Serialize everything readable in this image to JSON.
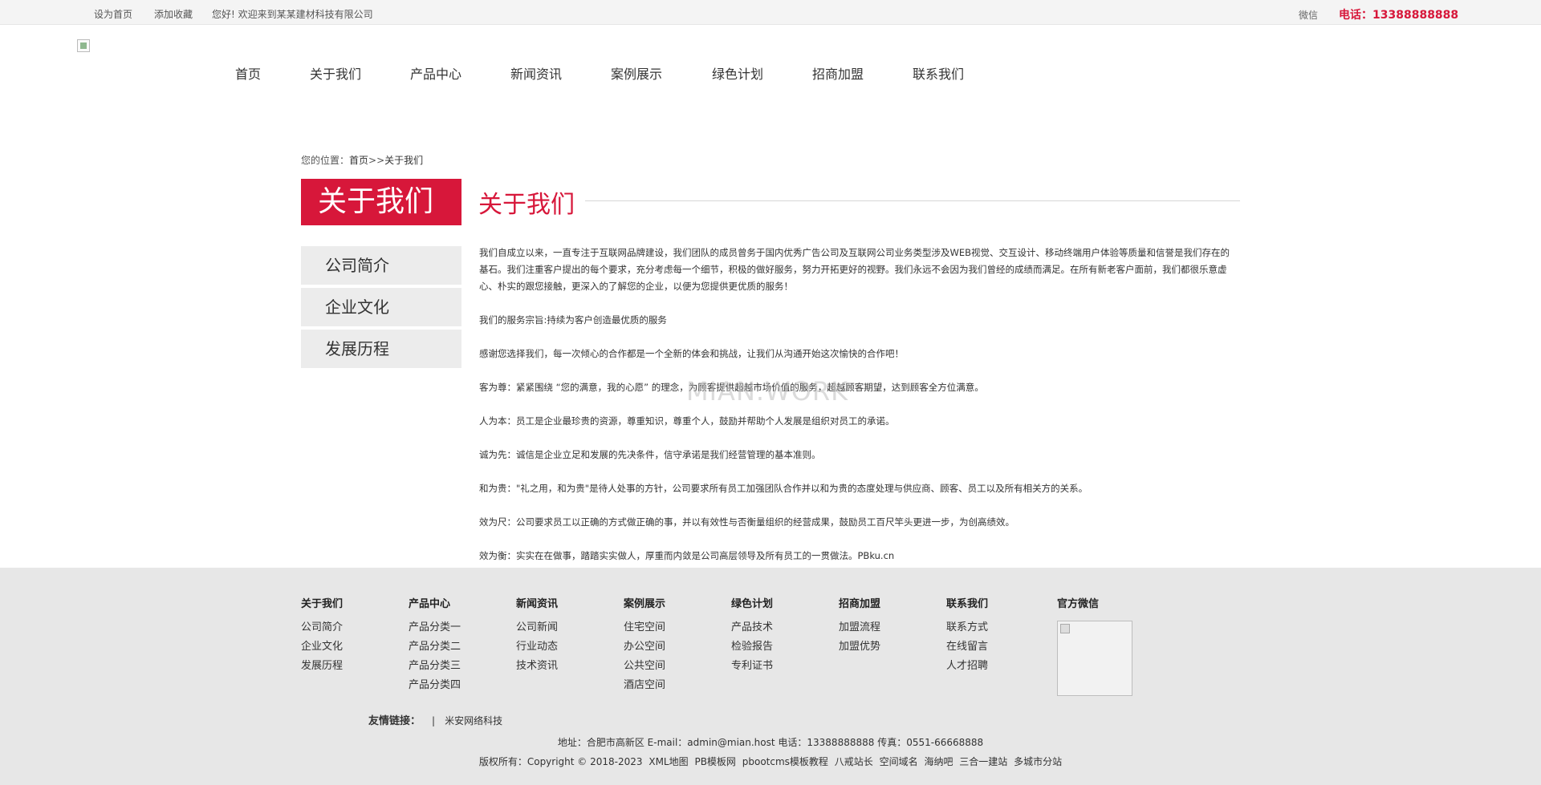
{
  "topbar": {
    "set_home": "设为首页",
    "add_fav": "添加收藏",
    "welcome": "您好! 欢迎来到某某建材科技有限公司",
    "wechat": "微信",
    "phone": "电话：13388888888"
  },
  "nav": [
    "首页",
    "关于我们",
    "产品中心",
    "新闻资讯",
    "案例展示",
    "绿色计划",
    "招商加盟",
    "联系我们"
  ],
  "breadcrumb": {
    "prefix": "您的位置：",
    "home": "首页",
    "sep": ">>",
    "current": "关于我们"
  },
  "sidebar": {
    "title": "关于我们",
    "items": [
      "公司简介",
      "企业文化",
      "发展历程"
    ]
  },
  "content": {
    "title": "关于我们",
    "p1": "我们自成立以来，一直专注于互联网品牌建设，我们团队的成员曾务于国内优秀广告公司及互联网公司业务类型涉及WEB视觉、交互设计、移动终端用户体验等质量和信誉是我们存在的基石。我们注重客户提出的每个要求，充分考虑每一个细节，积极的做好服务，努力开拓更好的视野。我们永远不会因为我们曾经的成绩而满足。在所有新老客户面前，我们都很乐意虚心、朴实的跟您接触，更深入的了解您的企业，以便为您提供更优质的服务！",
    "p2": "我们的服务宗旨:持续为客户创造最优质的服务",
    "p3": "感谢您选择我们，每一次倾心的合作都是一个全新的体会和挑战，让我们从沟通开始这次愉快的合作吧！",
    "p4": "客为尊：紧紧围绕 “您的满意，我的心愿” 的理念，为顾客提供超越市场价值的服务，超越顾客期望，达到顾客全方位满意。",
    "p5": "人为本：员工是企业最珍贵的资源，尊重知识，尊重个人，鼓励并帮助个人发展是组织对员工的承诺。",
    "p6": "诚为先：诚信是企业立足和发展的先决条件，信守承诺是我们经营管理的基本准则。",
    "p7": "和为贵：\"礼之用，和为贵\"是待人处事的方针，公司要求所有员工加强团队合作并以和为贵的态度处理与供应商、顾客、员工以及所有相关方的关系。",
    "p8": "效为尺：公司要求员工以正确的方式做正确的事，并以有效性与否衡量组织的经营成果，鼓励员工百尺竿头更进一步，为创高绩效。",
    "p9": "效为衡：实实在在做事，踏踏实实做人，厚重而内敛是公司高层领导及所有员工的一贯做法。PBku.cn",
    "watermark": "MIAN.WORK"
  },
  "footer": {
    "columns": [
      {
        "title": "关于我们",
        "links": [
          "公司简介",
          "企业文化",
          "发展历程"
        ]
      },
      {
        "title": "产品中心",
        "links": [
          "产品分类一",
          "产品分类二",
          "产品分类三",
          "产品分类四"
        ]
      },
      {
        "title": "新闻资讯",
        "links": [
          "公司新闻",
          "行业动态",
          "技术资讯"
        ]
      },
      {
        "title": "案例展示",
        "links": [
          "住宅空间",
          "办公空间",
          "公共空间",
          "酒店空间"
        ]
      },
      {
        "title": "绿色计划",
        "links": [
          "产品技术",
          "检验报告",
          "专利证书"
        ]
      },
      {
        "title": "招商加盟",
        "links": [
          "加盟流程",
          "加盟优势"
        ]
      },
      {
        "title": "联系我们",
        "links": [
          "联系方式",
          "在线留言",
          "人才招聘"
        ]
      }
    ],
    "wechat_title": "官方微信",
    "friend_label": "友情链接：",
    "friend_sep": "|",
    "friend_link": "米安网络科技",
    "address_line": "地址：合肥市高新区   E-mail：admin@mian.host   电话：13388888888   传真：0551-66668888",
    "copyright": "版权所有：Copyright © 2018-2023",
    "copy_links": [
      "XML地图",
      "PB模板网",
      "pbootcms模板教程",
      "八戒站长",
      "空间域名",
      "海纳吧",
      "三合一建站",
      "多城市分站"
    ]
  },
  "colors": {
    "accent": "#d7173a",
    "sidebar_bg": "#ececec",
    "footer_bg": "#e7e7e7"
  }
}
